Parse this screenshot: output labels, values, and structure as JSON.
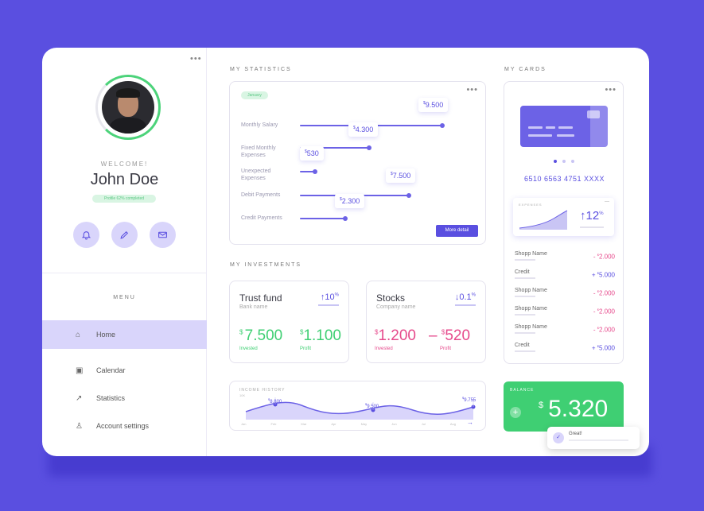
{
  "sidebar": {
    "welcome": "WELCOME!",
    "user_name": "John Doe",
    "profile_badge": "Profile 62% completed",
    "menu_title": "MENU",
    "items": [
      {
        "label": "Home",
        "icon": "home-icon"
      },
      {
        "label": "Calendar",
        "icon": "calendar-icon"
      },
      {
        "label": "Statistics",
        "icon": "arrow-up-right-icon"
      },
      {
        "label": "Account settings",
        "icon": "user-icon"
      }
    ],
    "action_icons": [
      "bell-icon",
      "pencil-icon",
      "mail-icon"
    ]
  },
  "statistics": {
    "section_label": "MY STATISTICS",
    "tag": "January",
    "rows": [
      {
        "label": "Monthly Salary",
        "value": "9.500",
        "currency": "$"
      },
      {
        "label": "Fixed Monthly Expenses",
        "value": "4.300",
        "currency": "$"
      },
      {
        "label": "Unexpected Expenses",
        "value": "530",
        "currency": "$"
      },
      {
        "label": "Debit Payments",
        "value": "7.500",
        "currency": "$"
      },
      {
        "label": "Credit Payments",
        "value": "2.300",
        "currency": "$"
      }
    ],
    "more_button": "More detail"
  },
  "investments": {
    "section_label": "MY INVESTMENTS",
    "funds": [
      {
        "title": "Trust fund",
        "subtitle": "Bank name",
        "pct": "10",
        "pct_arrow": "↑",
        "invested": "7.500",
        "profit": "1.100",
        "invested_label": "Invested",
        "profit_label": "Profit",
        "tone": "green"
      },
      {
        "title": "Stocks",
        "subtitle": "Company name",
        "pct": "0.1",
        "pct_arrow": "↓",
        "invested": "1.200",
        "profit": "520",
        "invested_label": "Invested",
        "profit_label": "Profit",
        "tone": "pink"
      }
    ]
  },
  "income_history": {
    "title": "INCOME HISTORY",
    "months": [
      "Jan",
      "Feb",
      "Mar",
      "Apr",
      "May",
      "Jun",
      "Jul",
      "Aug"
    ],
    "annotations": [
      {
        "month": "Feb",
        "value": "8.800"
      },
      {
        "month": "May",
        "value": "9.500"
      },
      {
        "month": "Aug",
        "value": "9.755"
      }
    ],
    "y_label": "10K"
  },
  "cards": {
    "section_label": "MY CARDS",
    "card_number": "6510 6563 4751 XXXX",
    "expenses_title": "EXPENSES",
    "expenses_pct": "12",
    "transactions": [
      {
        "name": "Shopp Name",
        "amount": "2.000",
        "sign": "-",
        "tone": "pink"
      },
      {
        "name": "Credit",
        "amount": "5.000",
        "sign": "+",
        "tone": "blue"
      },
      {
        "name": "Shopp Name",
        "amount": "2.000",
        "sign": "-",
        "tone": "pink"
      },
      {
        "name": "Shopp Name",
        "amount": "2.000",
        "sign": "-",
        "tone": "pink"
      },
      {
        "name": "Shopp Name",
        "amount": "2.000",
        "sign": "-",
        "tone": "pink"
      },
      {
        "name": "Credit",
        "amount": "5.000",
        "sign": "+",
        "tone": "blue"
      }
    ]
  },
  "balance": {
    "title": "BALANCE",
    "value": "5.320",
    "currency": "$"
  },
  "toast": {
    "title": "Great!"
  },
  "colors": {
    "accent": "#5a4fe0",
    "green": "#3fcf73",
    "pink": "#e64a8c",
    "background": "#5a4fe0"
  }
}
